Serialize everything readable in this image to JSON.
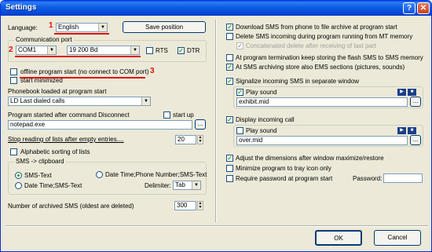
{
  "window": {
    "title": "Settings",
    "help": "?",
    "close": "✕"
  },
  "language": {
    "label": "Language:",
    "value": "English",
    "marker": "1"
  },
  "save_position": "Save position",
  "comm_port": {
    "legend": "Communication port",
    "port": "COM1",
    "speed": "19 200 Bd",
    "rts": "RTS",
    "dtr": "DTR",
    "marker": "2"
  },
  "offline": {
    "label": "offline program start (no connect to COM port)",
    "marker": "3"
  },
  "start_minimized": "start minimized",
  "phonebook": {
    "label": "Phonebook loaded at program start",
    "value": "LD  Last dialed calls"
  },
  "after_disconnect": {
    "label": "Program started after command Disconnect",
    "startup": "start up",
    "value": "notepad.exe",
    "browse": "..."
  },
  "stop_reading": {
    "label": "Stop reading of lists after empty entries....",
    "value": "20"
  },
  "alpha_sorting": "Alphabetic sorting of lists",
  "clipboard": {
    "legend": "SMS -> clipboard",
    "opt1": "SMS-Text",
    "opt2": "Date Time;SMS-Text",
    "opt3": "Date Time;Phone Number;SMS-Text",
    "delimiter_label": "Delimiter:",
    "delimiter_value": "Tab"
  },
  "archived": {
    "label": "Number of archived SMS (oldest are deleted)",
    "value": "300"
  },
  "right": {
    "download": "Download SMS from phone to file archive at program start",
    "delete": "Delete SMS incoming during program running from MT memory",
    "concat": "Concatenated delete after receiving of last part",
    "flash": "At program termination keep storing the flash SMS to SMS memory",
    "ems": "At SMS archiving store also EMS sections (pictures, sounds)",
    "signalize": "Signalize incoming SMS in separate window",
    "play_sound_1": "Play sound",
    "sound_file_1": "exhibit.mid",
    "display_call": "Display incoming call",
    "play_sound_2": "Play sound",
    "sound_file_2": "over.mid",
    "adjust": "Adjust the dimensions after window maximize/restore",
    "minimize": "Minimize program to tray icon only",
    "password_req": "Require password at program start",
    "password_label": "Password:",
    "browse": "..."
  },
  "ok": "OK",
  "cancel": "Cancel"
}
